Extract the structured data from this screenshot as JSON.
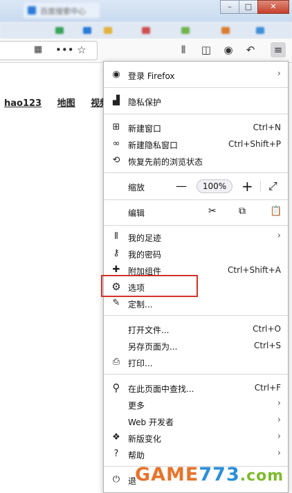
{
  "window": {
    "tab_title": "百度搜索中心",
    "controls": [
      "–",
      "□",
      "✕"
    ]
  },
  "page": {
    "links": [
      "hao123",
      "地图",
      "视频"
    ]
  },
  "navbar_icons": [
    "qr-icon",
    "more-icon",
    "bookmark-star-icon",
    "library-icon",
    "sidebar-icon",
    "account-icon",
    "back-arrow-icon",
    "hamburger-menu-icon"
  ],
  "menu": {
    "sign_in": "登录 Firefox",
    "privacy": "隐私保护",
    "new_window": {
      "label": "新建窗口",
      "shortcut": "Ctrl+N"
    },
    "new_private_window": {
      "label": "新建隐私窗口",
      "shortcut": "Ctrl+Shift+P"
    },
    "restore_session": "恢复先前的浏览状态",
    "zoom": {
      "label": "缩放",
      "minus": "—",
      "value": "100%",
      "plus": "+",
      "fullscreen": "⤢"
    },
    "edit": {
      "label": "编辑"
    },
    "library": "我的足迹",
    "logins": "我的密码",
    "addons": {
      "label": "附加组件",
      "shortcut": "Ctrl+Shift+A"
    },
    "options": "选项",
    "customize": "定制...",
    "open_file": {
      "label": "打开文件...",
      "shortcut": "Ctrl+O"
    },
    "save_page": {
      "label": "另存页面为...",
      "shortcut": "Ctrl+S"
    },
    "print": "打印...",
    "find": {
      "label": "在此页面中查找...",
      "shortcut": "Ctrl+F"
    },
    "more": "更多",
    "web_developer": "Web 开发者",
    "whats_new": "新版变化",
    "help": "帮助",
    "quit": "退"
  },
  "watermark": {
    "part1": "GAME",
    "part2": "773",
    "part3": ".com"
  },
  "colors": {
    "highlight": "#d0312d",
    "accent": "#0a84ff"
  }
}
